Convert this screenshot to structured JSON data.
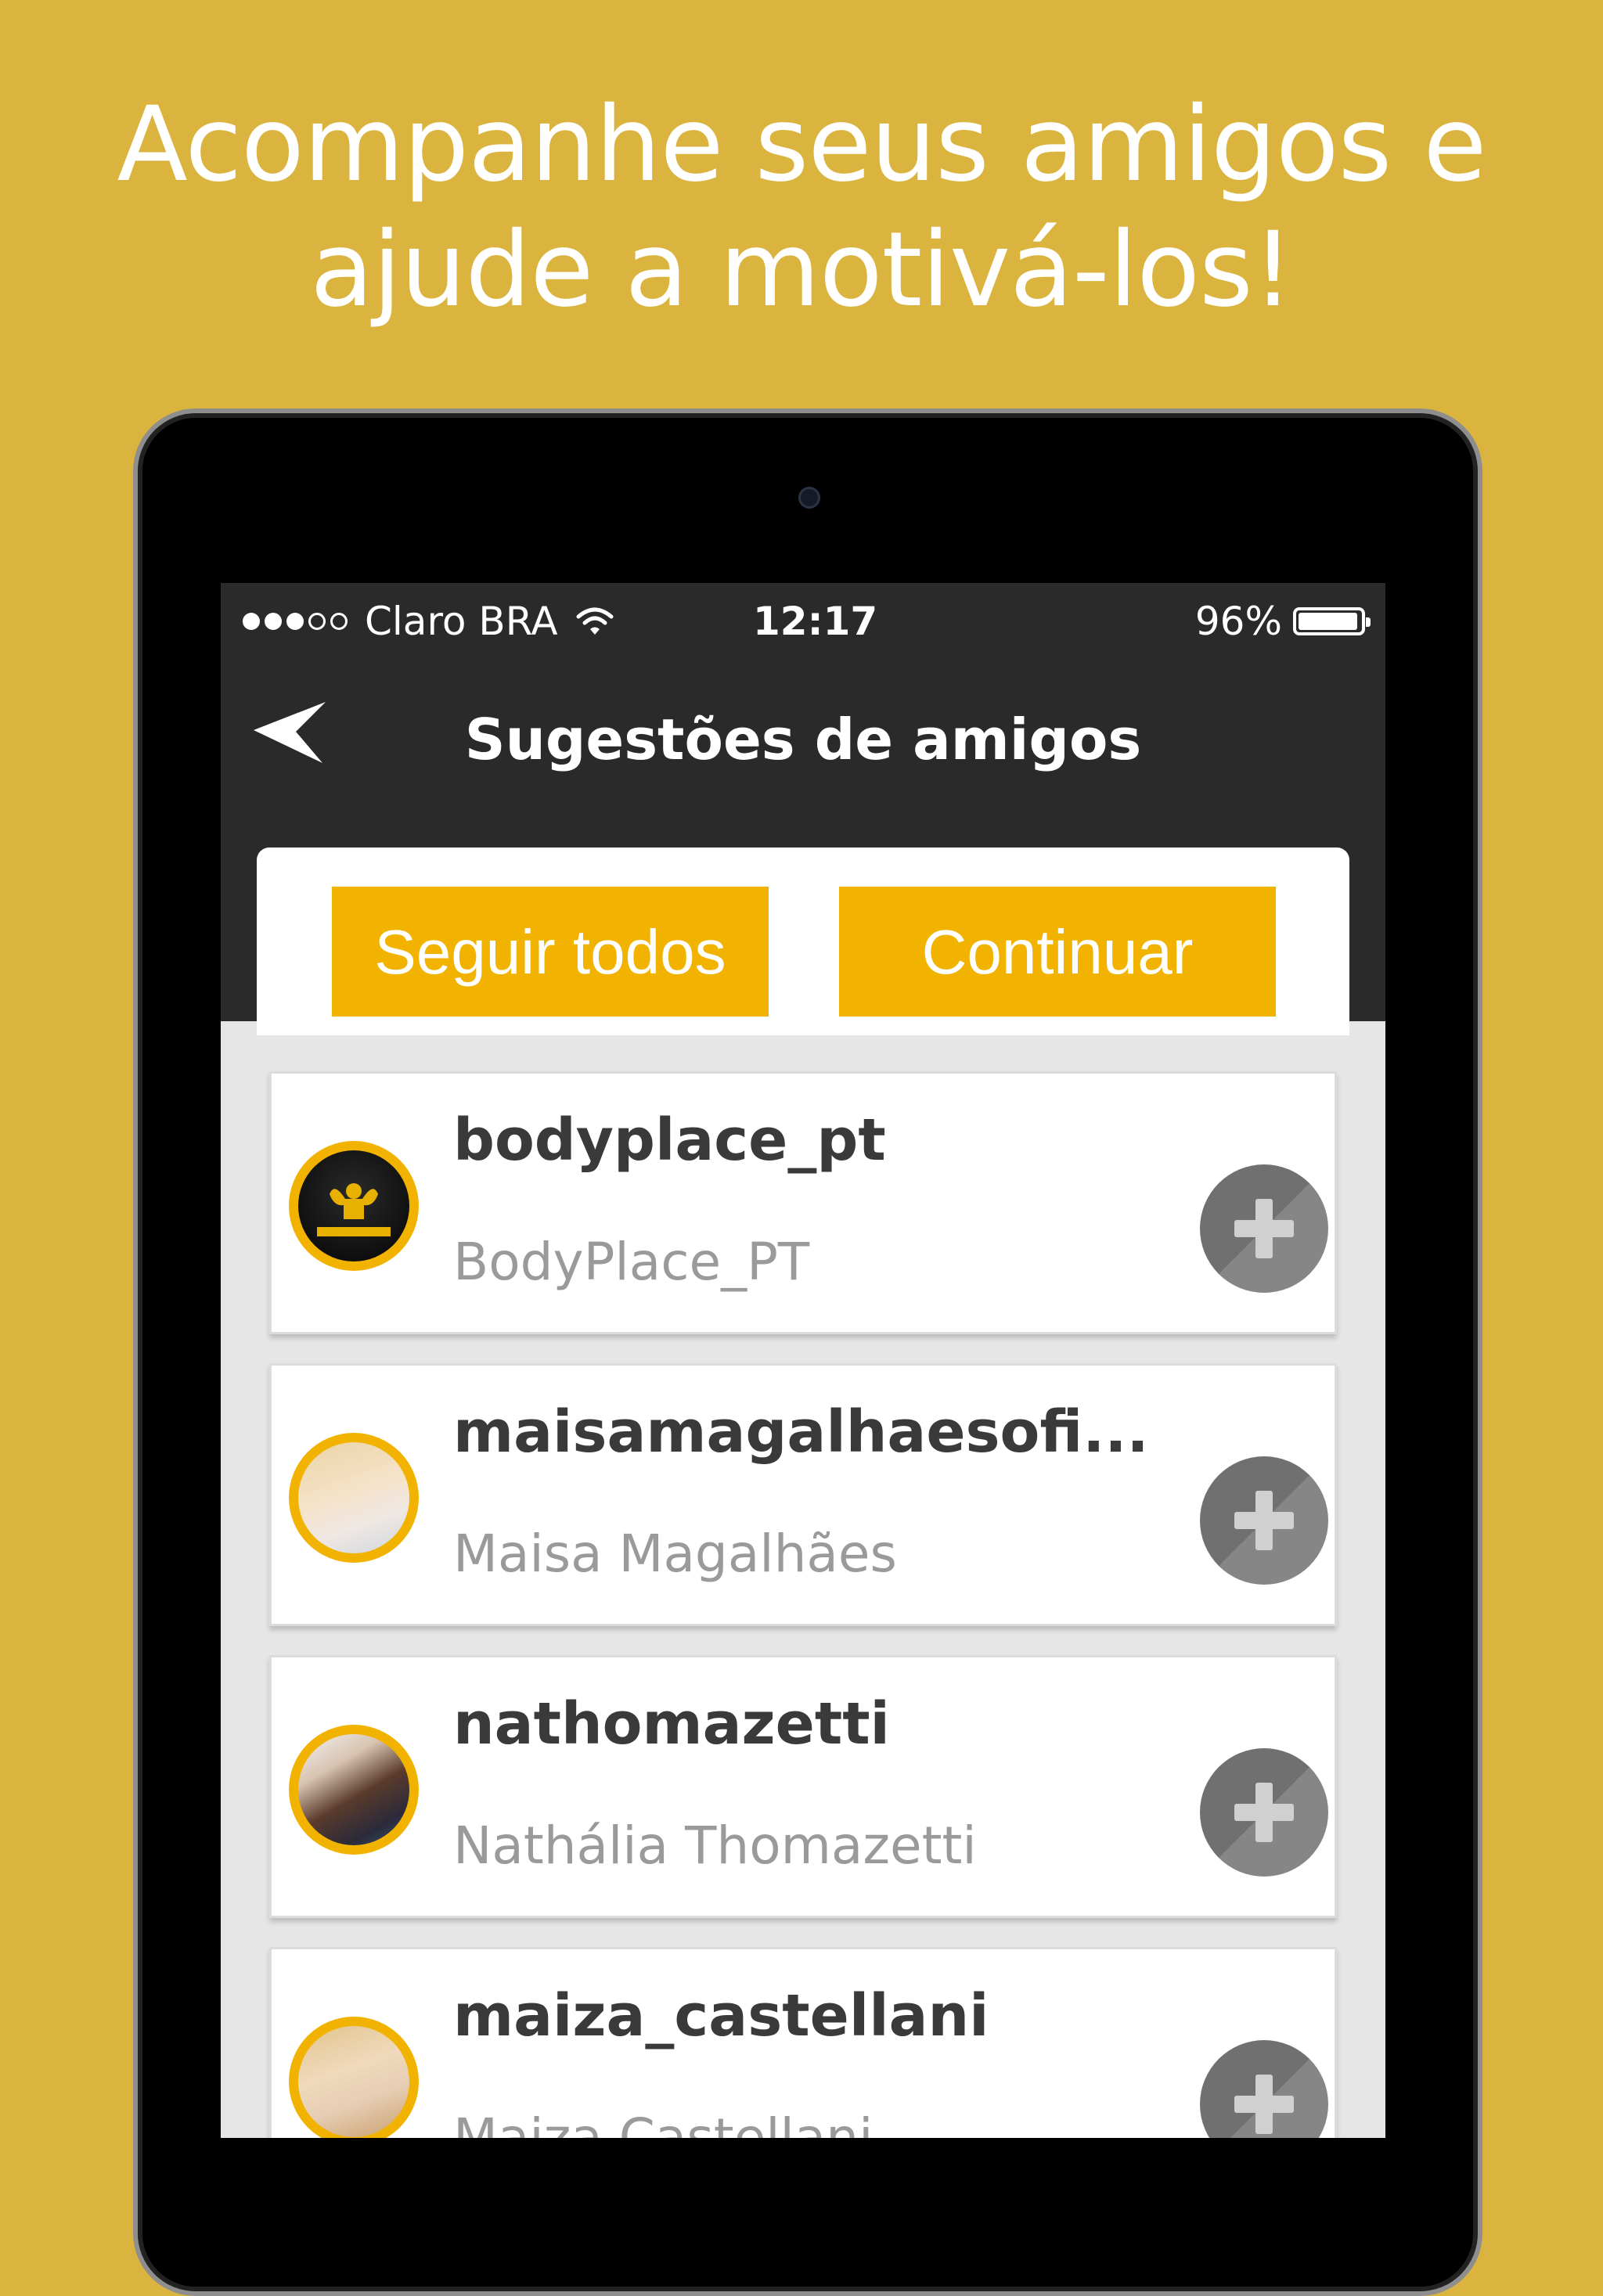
{
  "promo": {
    "line1": "Acompanhe seus amigos e",
    "line2": "ajude a motivá-los!"
  },
  "status_bar": {
    "carrier": "Claro BRA",
    "time": "12:17",
    "battery": "96%",
    "battery_level": 0.96
  },
  "nav": {
    "title": "Sugestões de amigos"
  },
  "actions": {
    "follow_all": "Seguir todos",
    "continue": "Continuar"
  },
  "suggestions": [
    {
      "username": "bodyplace_pt",
      "name": "BodyPlace_PT"
    },
    {
      "username": "maisamagalhaesofi...",
      "name": "Maisa Magalhães"
    },
    {
      "username": "nathomazetti",
      "name": "Nathália Thomazetti"
    },
    {
      "username": "maiza_castellani",
      "name": "Maiza Castellani"
    }
  ],
  "colors": {
    "background": "#DAB43E",
    "accent": "#F2B300",
    "appbar": "#2A2A2A"
  }
}
